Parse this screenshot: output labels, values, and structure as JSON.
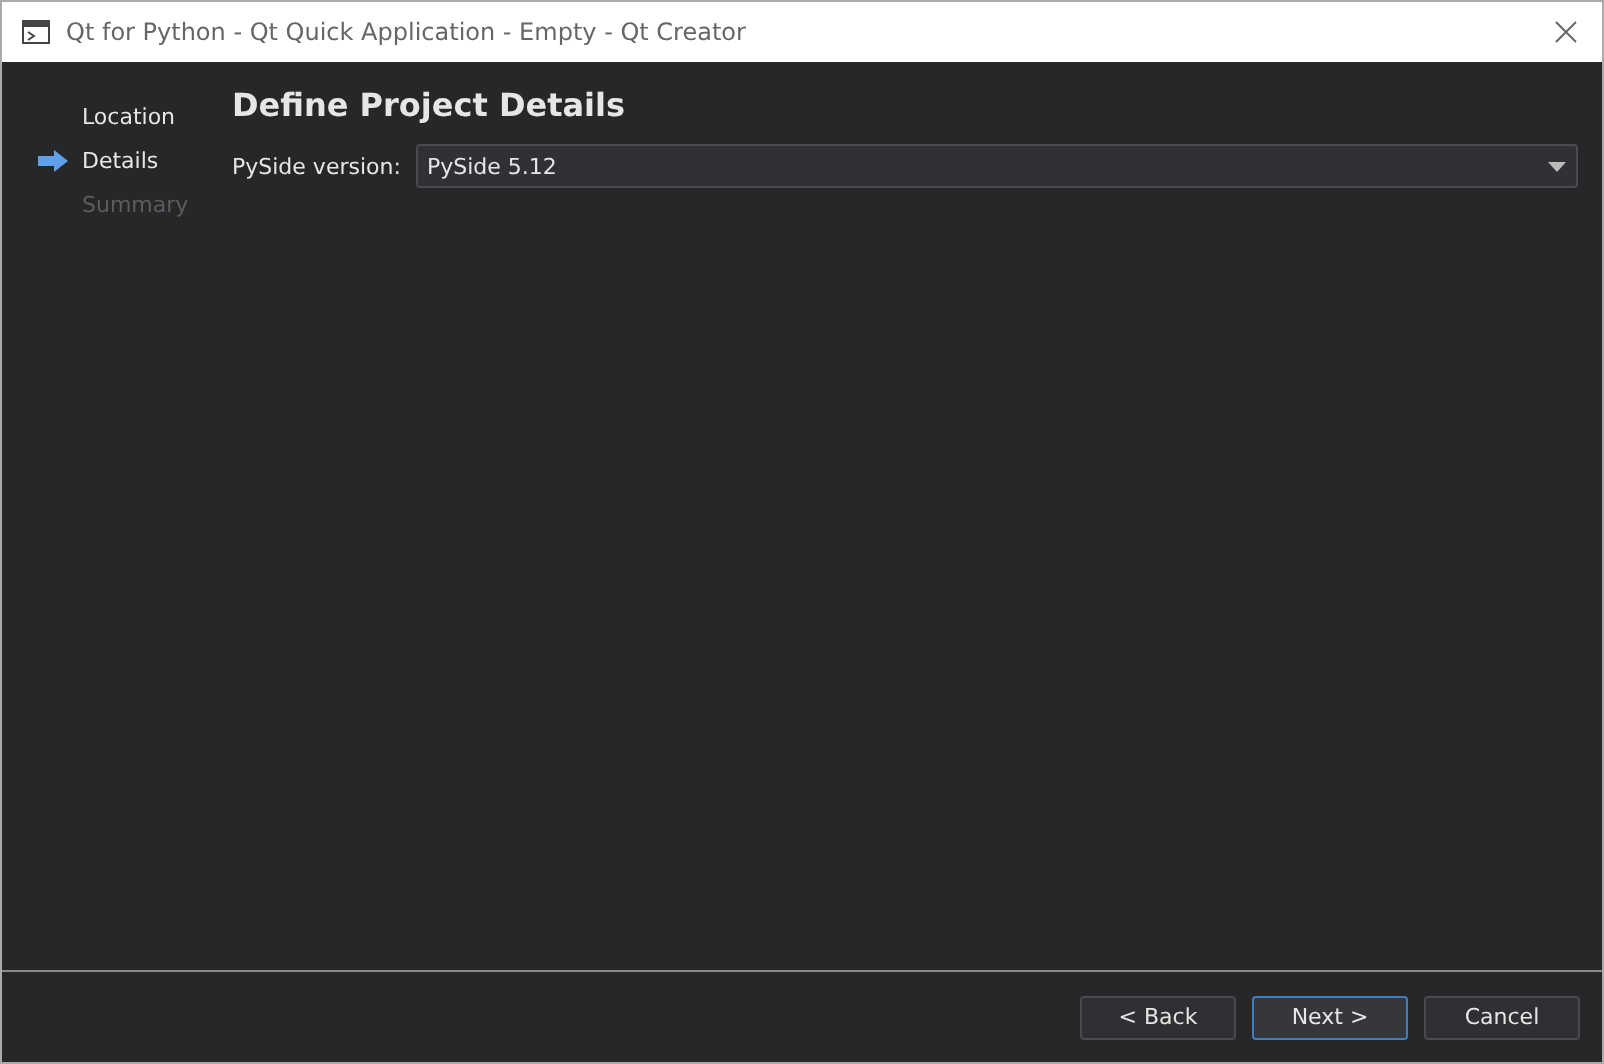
{
  "window": {
    "title": "Qt for Python - Qt Quick Application - Empty - Qt Creator"
  },
  "steps": [
    {
      "label": "Location",
      "selected": false,
      "disabled": false
    },
    {
      "label": "Details",
      "selected": true,
      "disabled": false
    },
    {
      "label": "Summary",
      "selected": false,
      "disabled": true
    }
  ],
  "page": {
    "heading": "Define Project Details",
    "field_label": "PySide version:",
    "combo_value": "PySide 5.12"
  },
  "buttons": [
    {
      "label": "< Back",
      "default": false
    },
    {
      "label": "Next >",
      "default": true
    },
    {
      "label": "Cancel",
      "default": false
    }
  ]
}
